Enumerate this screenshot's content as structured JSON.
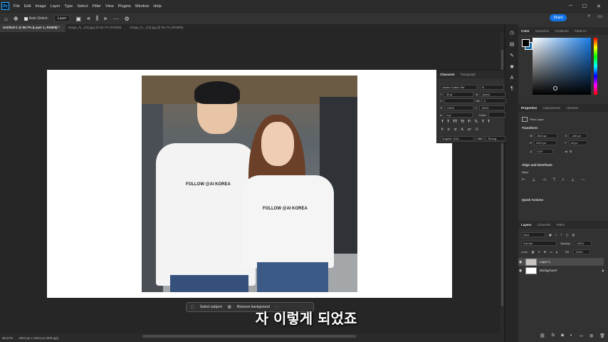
{
  "app": {
    "logo": "Ps"
  },
  "menu": [
    "File",
    "Edit",
    "Image",
    "Layer",
    "Type",
    "Select",
    "Filter",
    "View",
    "Plugins",
    "Window",
    "Help"
  ],
  "options_bar": {
    "auto_select_label": "Auto-Select:",
    "auto_select_value": "Layer"
  },
  "share_label": "Share",
  "tabs": [
    "Untitled-1 @ 66.7% (Layer 1, RGB/8) *",
    "image_fx_ (13).jpg @ 66.7% (RGB/8)",
    "image_fx_ (14).jpg @ 66.7% (RGB/8)"
  ],
  "status": {
    "zoom": "66.67%",
    "doc_size": "2024 px x 1024 px (300 ppi)"
  },
  "context_bar": {
    "select_subject": "Select subject",
    "remove_background": "Remove background"
  },
  "subtitle": "자 이렇게 되었죠",
  "photo": {
    "shirt_text_left": "FOLLOW @AI KOREA",
    "shirt_text_right": "FOLLOW @AI KOREA"
  },
  "color_panel": {
    "tabs": [
      "Color",
      "Swatches",
      "Gradients",
      "Patterns"
    ]
  },
  "character_panel": {
    "tabs": [
      "Character",
      "Paragraph"
    ],
    "font_family": "Adobe Gothic Std",
    "font_style": "B",
    "font_size": "30 pt",
    "leading": "(Auto)",
    "kerning": "",
    "tracking": "0",
    "vert_scale": "100%",
    "horiz_scale": "100%",
    "baseline": "0 pt",
    "color_label": "Color:",
    "language": "English: USA",
    "anti_alias": "Strong"
  },
  "properties_panel": {
    "tabs": [
      "Properties",
      "Adjustments",
      "Libraries"
    ],
    "layer_type": "Pixel Layer",
    "transform_title": "Transform",
    "w": "2024 px",
    "h": "2024 px",
    "x": "-436 px",
    "y": "18 px",
    "angle": "0.00°",
    "align_title": "Align and Distribute",
    "align_label": "Align:",
    "quick_actions_title": "Quick Actions"
  },
  "layers_panel": {
    "tabs": [
      "Layers",
      "Channels",
      "Paths"
    ],
    "filter": "Kind",
    "blend_mode": "Normal",
    "opacity_label": "Opacity:",
    "opacity": "100%",
    "lock_label": "Lock:",
    "fill_label": "Fill:",
    "fill": "100%",
    "layers": [
      {
        "name": "Layer 1"
      },
      {
        "name": "Background"
      }
    ]
  },
  "colors": {
    "accent": "#1473e6",
    "ps_blue": "#31a8ff"
  }
}
